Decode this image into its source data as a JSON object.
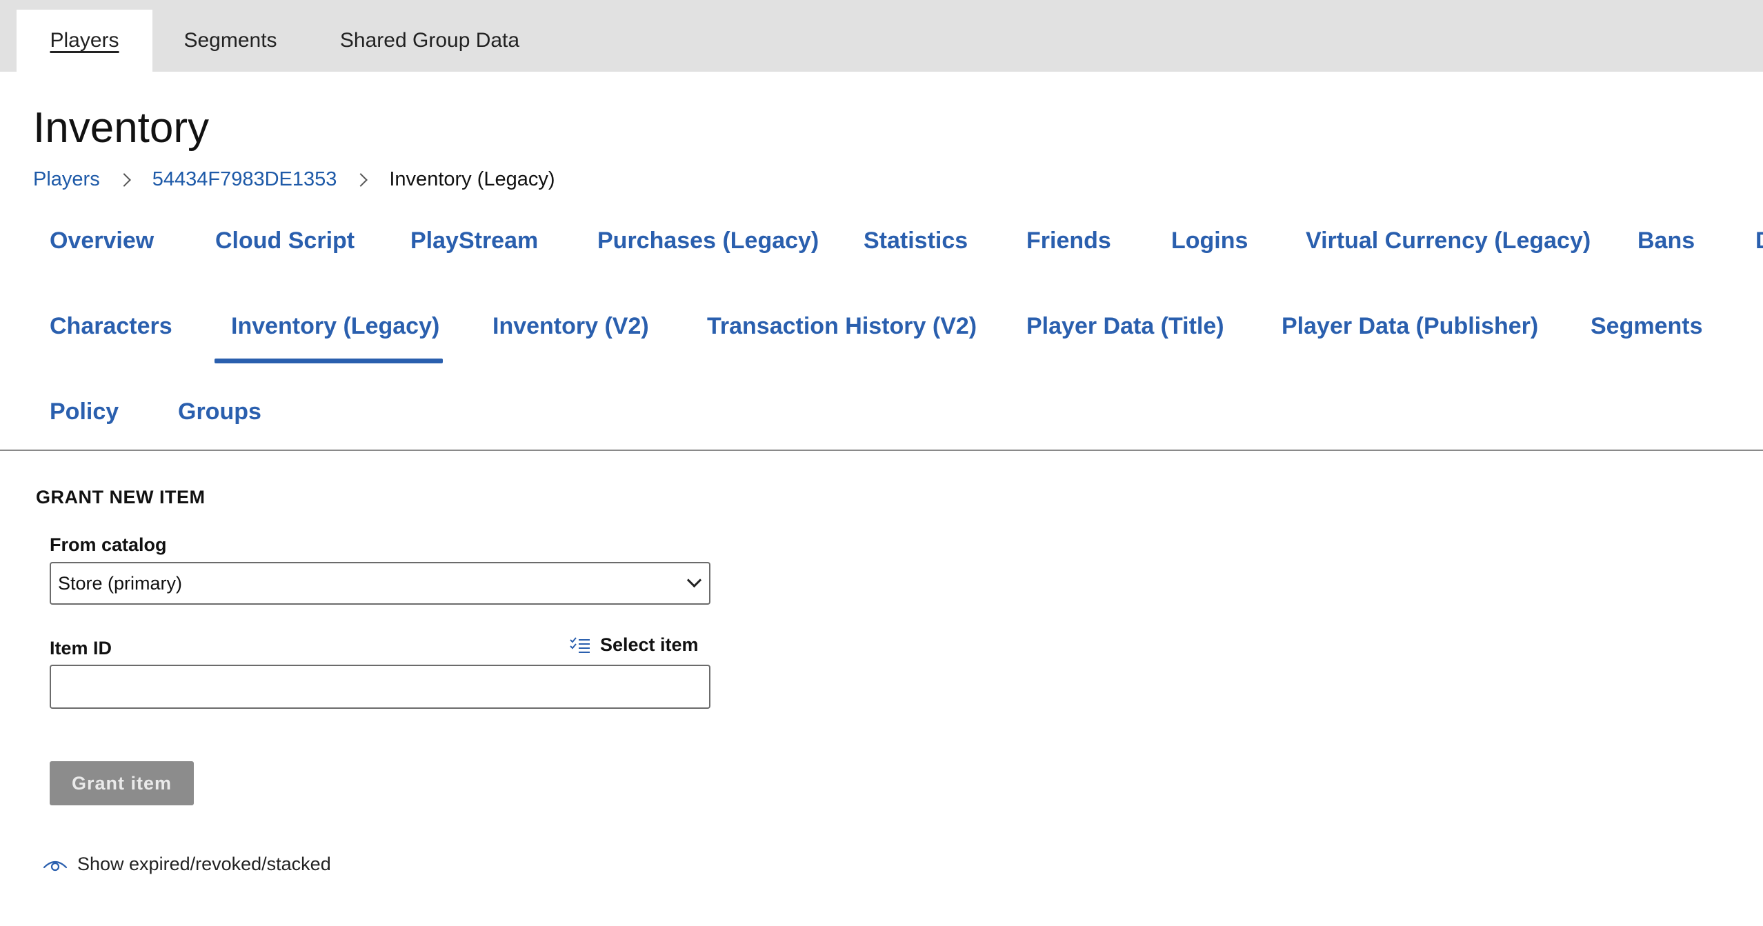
{
  "top_tabs": [
    {
      "label": "Players",
      "active": true
    },
    {
      "label": "Segments",
      "active": false
    },
    {
      "label": "Shared Group Data",
      "active": false
    }
  ],
  "page_title": "Inventory",
  "breadcrumb": {
    "items": [
      "Players",
      "54434F7983DE1353"
    ],
    "current": "Inventory (Legacy)"
  },
  "sub_tabs": {
    "row1": [
      "Overview",
      "Cloud Script",
      "PlayStream",
      "Purchases (Legacy)",
      "Statistics",
      "Friends",
      "Logins",
      "Virtual Currency (Legacy)",
      "Bans",
      "D"
    ],
    "row2": [
      "Characters",
      "Inventory (Legacy)",
      "Inventory (V2)",
      "Transaction History (V2)",
      "Player Data (Title)",
      "Player Data (Publisher)",
      "Segments"
    ],
    "row3": [
      "Policy",
      "Groups"
    ],
    "active": "Inventory (Legacy)"
  },
  "grant_section": {
    "title": "GRANT NEW ITEM",
    "catalog_label": "From catalog",
    "catalog_value": "Store (primary)",
    "item_id_label": "Item ID",
    "item_id_value": "",
    "select_item_label": "Select item",
    "grant_button_label": "Grant item"
  },
  "show_expired_label": "Show expired/revoked/stacked",
  "colors": {
    "accent": "#2a5fae",
    "link": "#1e5aa8",
    "topbar": "#e1e1e1",
    "disabled_button": "#8c8c8c"
  }
}
